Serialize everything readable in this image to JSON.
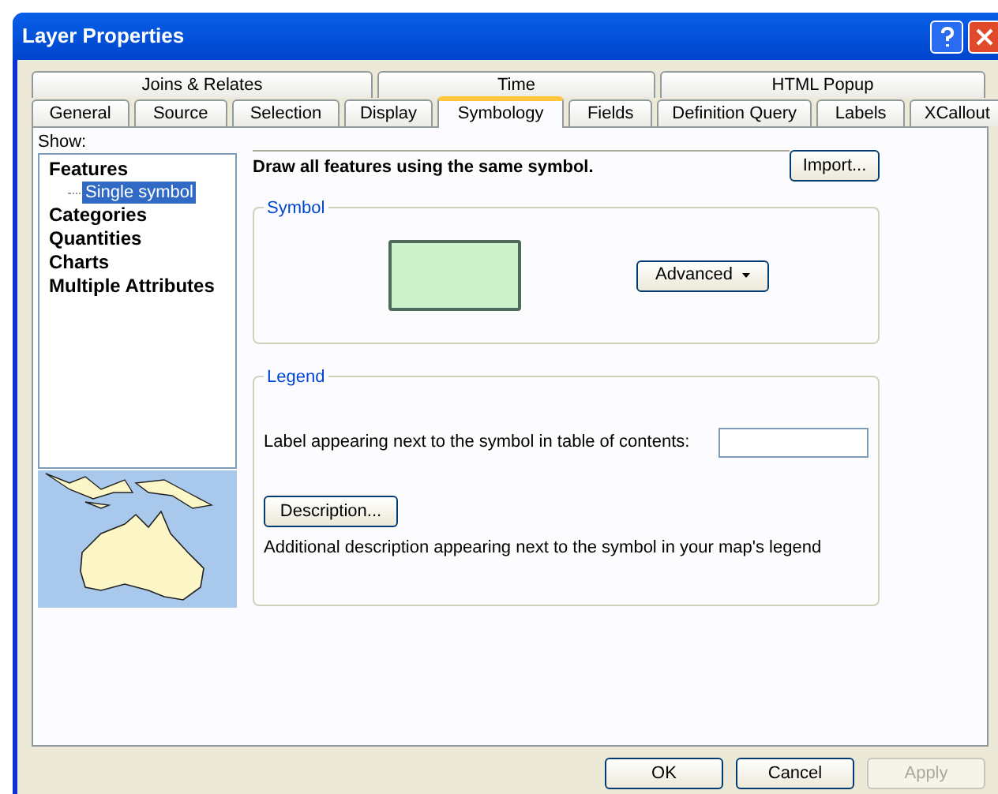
{
  "window": {
    "title": "Layer Properties"
  },
  "tab_rows": [
    [
      {
        "label": "Joins & Relates",
        "selected": false
      },
      {
        "label": "Time",
        "selected": false
      },
      {
        "label": "HTML Popup",
        "selected": false
      }
    ],
    [
      {
        "label": "General",
        "selected": false
      },
      {
        "label": "Source",
        "selected": false
      },
      {
        "label": "Selection",
        "selected": false
      },
      {
        "label": "Display",
        "selected": false
      },
      {
        "label": "Symbology",
        "selected": true
      },
      {
        "label": "Fields",
        "selected": false
      },
      {
        "label": "Definition Query",
        "selected": false
      },
      {
        "label": "Labels",
        "selected": false
      },
      {
        "label": "XCallout",
        "selected": false
      }
    ]
  ],
  "show": {
    "label": "Show:",
    "items": [
      {
        "label": "Features",
        "selected": false,
        "children": [
          {
            "label": "Single symbol",
            "selected": true
          }
        ]
      },
      {
        "label": "Categories",
        "selected": false
      },
      {
        "label": "Quantities",
        "selected": false
      },
      {
        "label": "Charts",
        "selected": false
      },
      {
        "label": "Multiple Attributes",
        "selected": false
      }
    ]
  },
  "heading": "Draw all features using the same symbol.",
  "import_button": "Import...",
  "symbol_group": {
    "title": "Symbol",
    "color": "#ccf2cc",
    "advanced_button": "Advanced"
  },
  "legend_group": {
    "title": "Legend",
    "label_prompt": "Label appearing next to the symbol in table of contents:",
    "description_button": "Description...",
    "description_note": "Additional description appearing next to the symbol in your map's legend"
  },
  "buttons": [
    {
      "label": "OK",
      "disabled": false
    },
    {
      "label": "Cancel",
      "disabled": false
    },
    {
      "label": "Apply",
      "disabled": true
    }
  ]
}
